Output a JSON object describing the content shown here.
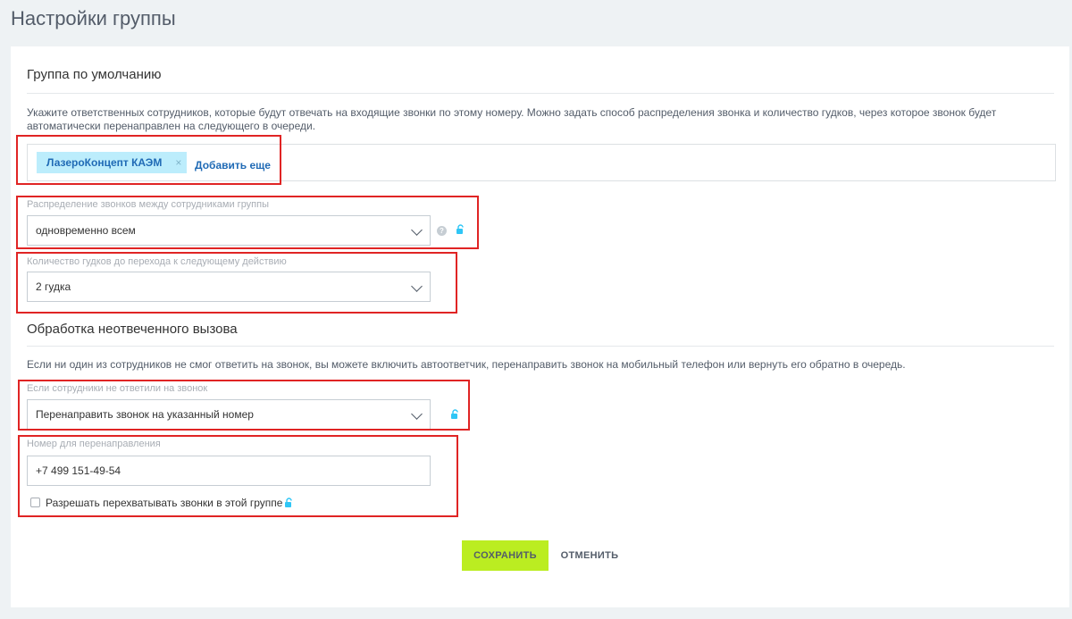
{
  "page_title": "Настройки группы",
  "default_group": {
    "title": "Группа по умолчанию",
    "description": "Укажите ответственных сотрудников, которые будут отвечать на входящие звонки по этому номеру. Можно задать способ распределения звонка и количество гудков, через которое звонок будет автоматически перенаправлен на следующего в очереди.",
    "selected_user": "ЛазероКонцепт КАЭМ",
    "chip_remove": "×",
    "add_more": "Добавить еще",
    "distribution_label": "Распределение звонков между сотрудниками группы",
    "distribution_value": "одновременно всем",
    "hint": "?",
    "rings_label": "Количество гудков до перехода к следующему действию",
    "rings_value": "2 гудка"
  },
  "unanswered": {
    "title": "Обработка неотвеченного вызова",
    "description": "Если ни один из сотрудников не смог ответить на звонок, вы можете включить автоответчик, перенаправить звонок на мобильный телефон или вернуть его обратно в очередь.",
    "action_label": "Если сотрудники не ответили на звонок",
    "action_value": "Перенаправить звонок на указанный номер",
    "number_label": "Номер для перенаправления",
    "number_value": "+7 499 151-49-54",
    "intercept_label": "Разрешать перехватывать звонки в этой группе",
    "intercept_checked": false
  },
  "buttons": {
    "save": "СОХРАНИТЬ",
    "cancel": "ОТМЕНИТЬ"
  },
  "colors": {
    "accent_button": "#bbed21",
    "highlight": "#e02424",
    "link": "#1f6ab5",
    "chip_bg": "#bcedfc"
  }
}
